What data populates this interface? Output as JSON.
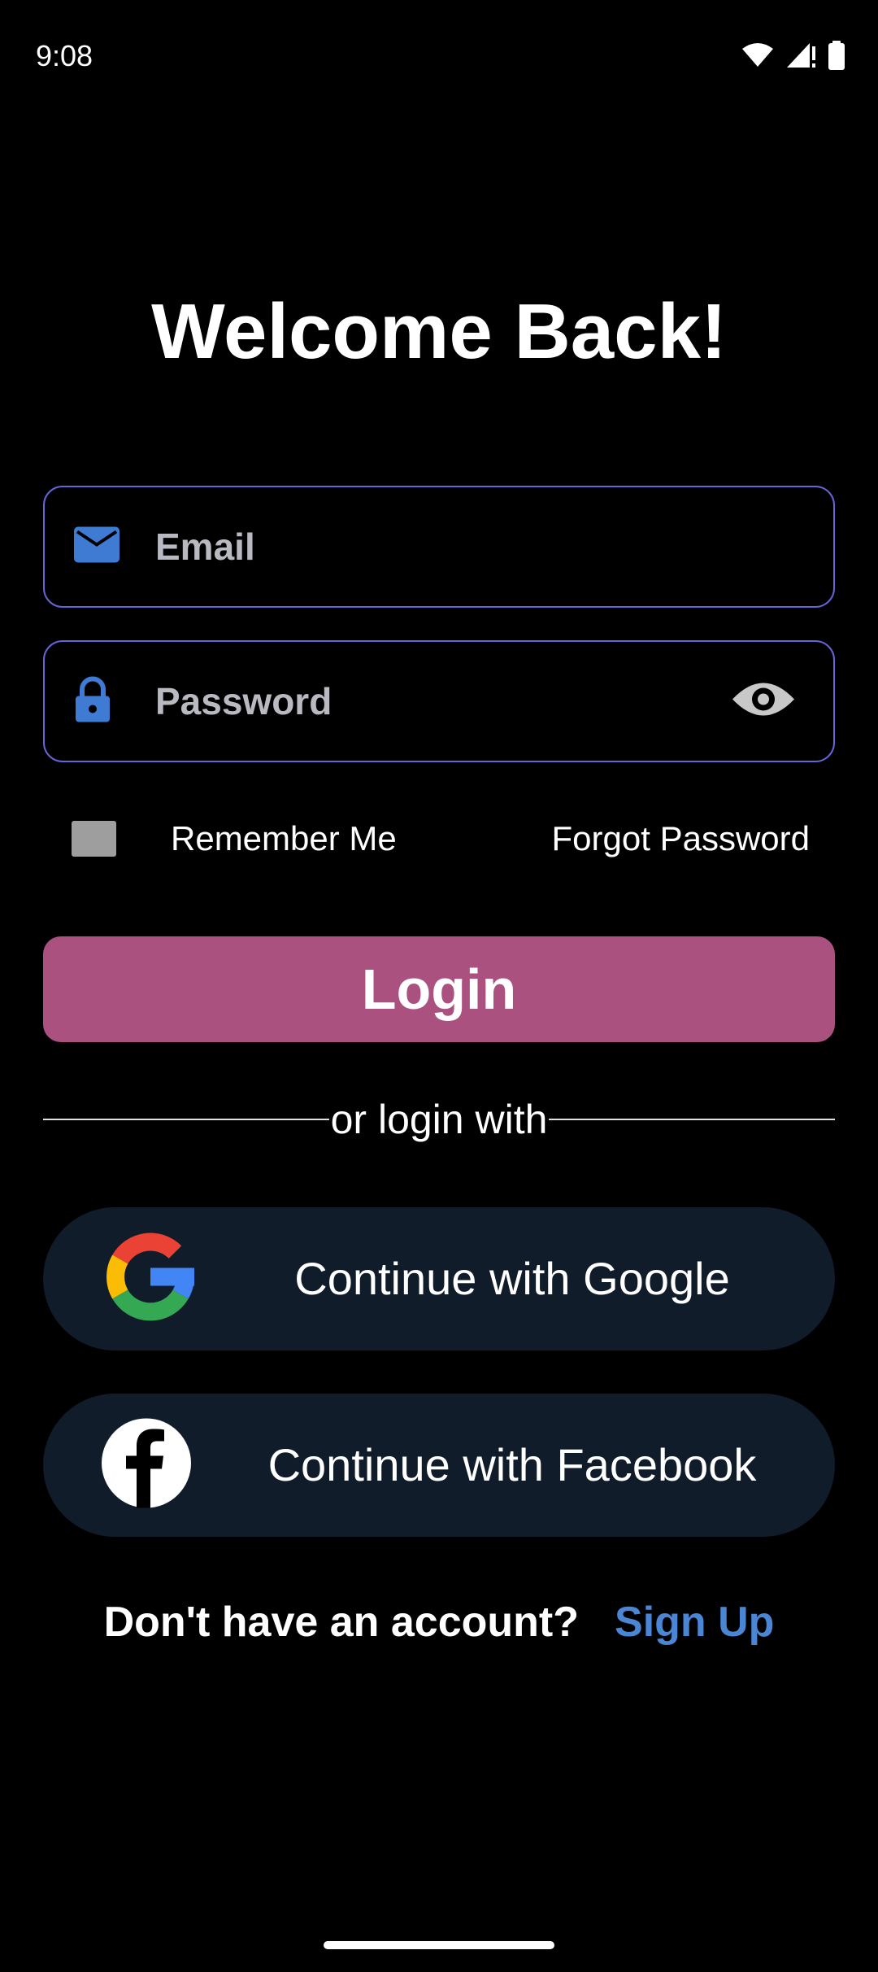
{
  "status_bar": {
    "time": "9:08"
  },
  "title": "Welcome Back!",
  "email_field": {
    "placeholder": "Email",
    "value": "",
    "icon": "mail-icon"
  },
  "password_field": {
    "placeholder": "Password",
    "value": "",
    "icon": "lock-icon",
    "toggle_icon": "eye-icon"
  },
  "remember_me": {
    "label": "Remember Me",
    "checked": false
  },
  "forgot_password": "Forgot Password",
  "login_button": "Login",
  "divider_text": "or login with",
  "social": {
    "google_label": "Continue with Google",
    "facebook_label": "Continue with Facebook"
  },
  "signup": {
    "prompt": "Don't have an account?",
    "link": "Sign Up"
  },
  "colors": {
    "background": "#000000",
    "field_border": "#6664d6",
    "icon_blue": "#3f7bd3",
    "login_button": "#ab5180",
    "social_button": "#111c2a",
    "link_blue": "#4a86d4",
    "checkbox": "#9e9e9e"
  }
}
